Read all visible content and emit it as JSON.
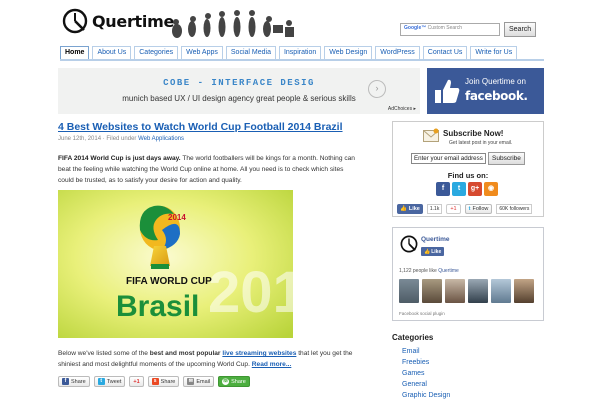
{
  "header": {
    "site_name": "Quertime",
    "search_placeholder": "Custom Search",
    "search_placeholder_brand": "Google™",
    "search_button": "Search"
  },
  "nav": {
    "items": [
      "Home",
      "About Us",
      "Categories",
      "Web Apps",
      "Social Media",
      "Inspiration",
      "Web Design",
      "WordPress",
      "Contact Us",
      "Write for Us"
    ],
    "active_index": 0
  },
  "ad": {
    "title": "COBE - INTERFACE DESIG",
    "subtitle": "munich based UX / UI design agency great people & serious skills",
    "adchoices": "AdChoices ▸"
  },
  "fb_join": {
    "top": "Join Quertime on",
    "brand": "facebook."
  },
  "post": {
    "title": "4 Best Websites to Watch World Cup Football 2014 Brazil",
    "date": "June 12th, 2014",
    "filed_under": "· Filed under",
    "category": "Web Applications",
    "intro_bold": "FIFA 2014 World Cup is just days away.",
    "intro_rest": " The world footballers will be kings for a month. Nothing can beat the feeling while watching the World Cup online at home. All you need is to check which sites could be trusted, as to satisfy your desire for action and quality.",
    "more_prefix": "Below we've listed some of the ",
    "more_bold": "best and most popular",
    "more_link": "live streaming websites",
    "more_suffix": " that let you get the shiniest and most delightful moments of the upcoming World Cup. ",
    "read_more": "Read more..."
  },
  "image": {
    "line1": "FIFA WORLD CUP",
    "line2": "Brasil",
    "year": "2014",
    "bg_year": "201"
  },
  "share": {
    "items": [
      "Share",
      "Tweet",
      "+1",
      "Share",
      "Email",
      "Share"
    ]
  },
  "subscribe": {
    "title": "Subscribe Now!",
    "desc": "Get latest post in your email.",
    "input_value": "Enter your email address",
    "button": "Subscribe",
    "follow_title": "Find us on:",
    "fb_like": "Like",
    "fb_count": "1.1k",
    "gplus": "+1",
    "tw_follow": "Follow",
    "tw_count": "60K followers"
  },
  "fb_box": {
    "page_name": "Quertime",
    "like": "Like",
    "people_count": "1,122 people like",
    "people_page": "Quertime",
    "plugin": "Facebook social plugin"
  },
  "categories": {
    "title": "Categories",
    "items": [
      "Email",
      "Freebies",
      "Games",
      "General",
      "Graphic Design"
    ]
  },
  "colors": {
    "link": "#1a5fb4",
    "facebook": "#3b5998",
    "accent_ad": "#3a86c8"
  }
}
